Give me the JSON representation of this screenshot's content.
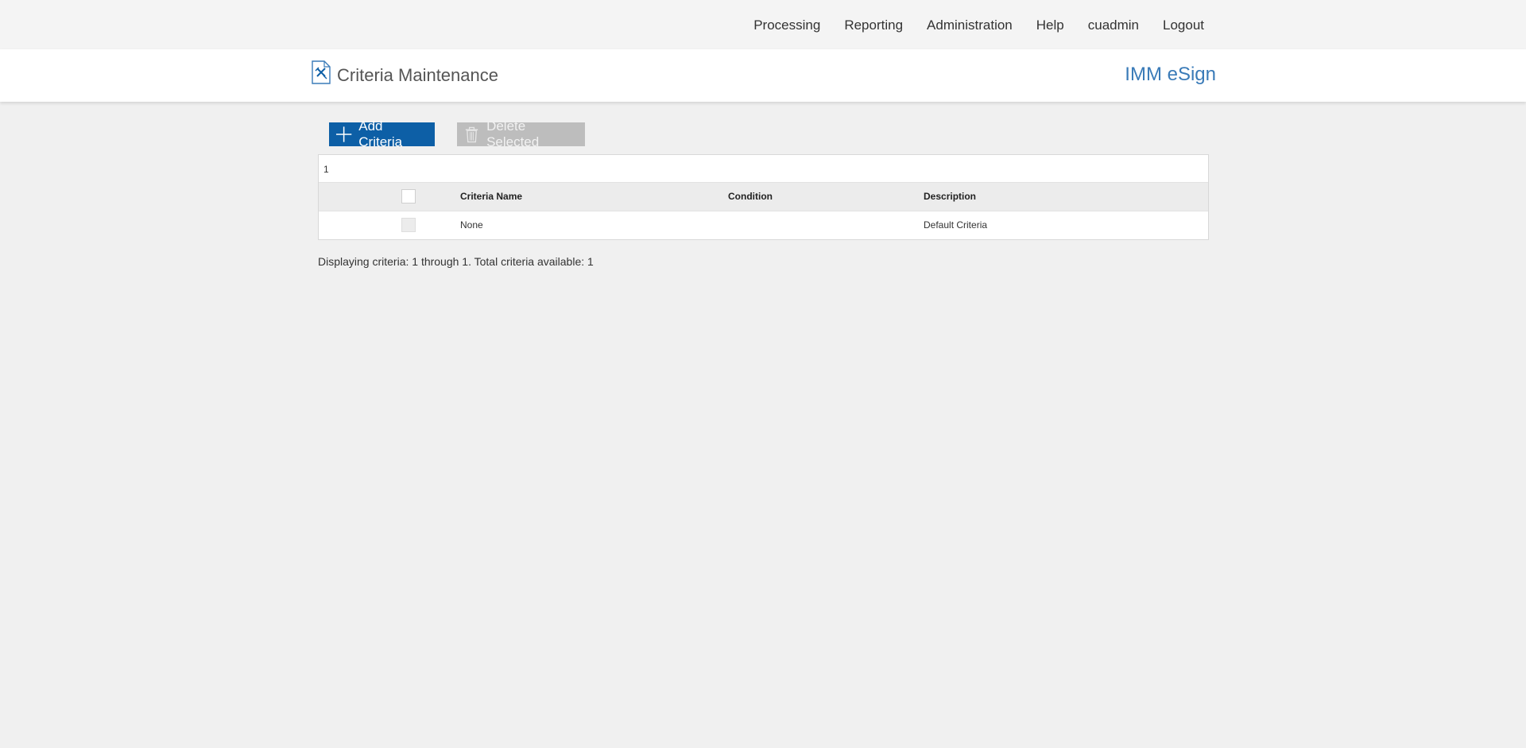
{
  "nav": {
    "items": [
      {
        "label": "Processing"
      },
      {
        "label": "Reporting"
      },
      {
        "label": "Administration"
      },
      {
        "label": "Help"
      },
      {
        "label": "cuadmin"
      },
      {
        "label": "Logout"
      }
    ]
  },
  "header": {
    "title": "Criteria Maintenance",
    "brand": "IMM eSign",
    "icon": "criteria-document-icon"
  },
  "toolbar": {
    "add_label": "Add Criteria",
    "add_icon": "plus-icon",
    "delete_label": "Delete Selected",
    "delete_icon": "trash-icon"
  },
  "grid": {
    "pager": "1",
    "columns": {
      "name": "Criteria Name",
      "condition": "Condition",
      "description": "Description"
    },
    "rows": [
      {
        "name": "None",
        "condition": "",
        "description": "Default Criteria"
      }
    ]
  },
  "status": "Displaying criteria: 1 through 1. Total criteria available: 1",
  "colors": {
    "accent": "#0d5fa6",
    "brand": "#3a7bb8",
    "disabled_button": "#bdbdbd",
    "background": "#f0f0f0"
  }
}
